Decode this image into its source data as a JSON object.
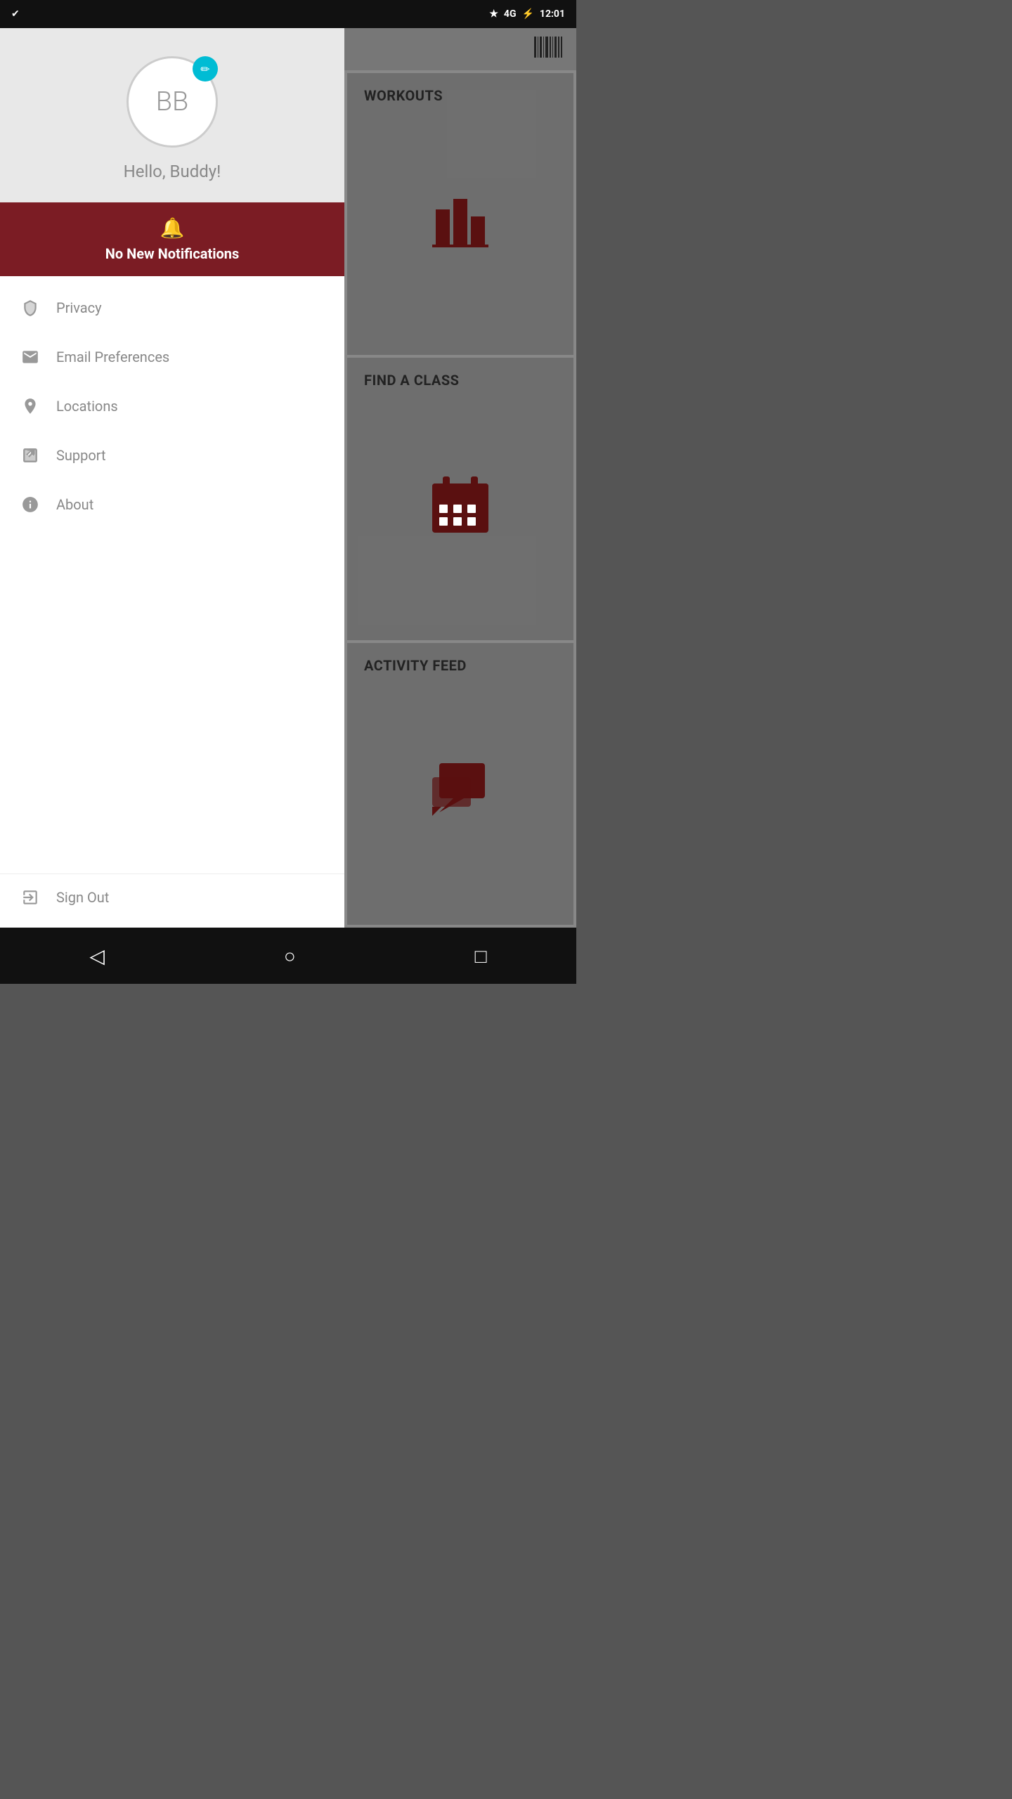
{
  "statusBar": {
    "time": "12:01",
    "icons": [
      "bluetooth",
      "signal-4g",
      "battery"
    ]
  },
  "drawer": {
    "avatar": {
      "initials": "BB",
      "editIcon": "pencil"
    },
    "greeting": "Hello, Buddy!",
    "notification": {
      "icon": "bell",
      "text": "No New Notifications"
    },
    "menuItems": [
      {
        "id": "privacy",
        "label": "Privacy",
        "icon": "shield"
      },
      {
        "id": "email-preferences",
        "label": "Email Preferences",
        "icon": "email"
      },
      {
        "id": "locations",
        "label": "Locations",
        "icon": "location"
      },
      {
        "id": "support",
        "label": "Support",
        "icon": "external-link"
      },
      {
        "id": "about",
        "label": "About",
        "icon": "info"
      }
    ],
    "signOut": {
      "label": "Sign Out",
      "icon": "sign-out"
    }
  },
  "appMain": {
    "cards": [
      {
        "id": "workouts",
        "title": "WORKOUTS",
        "icon": "bar-chart"
      },
      {
        "id": "find-a-class",
        "title": "FIND A CLASS",
        "icon": "calendar"
      },
      {
        "id": "activity-feed",
        "title": "ACTIVITY FEED",
        "icon": "chat"
      }
    ]
  },
  "navBar": {
    "back": "◁",
    "home": "○",
    "recent": "□"
  }
}
